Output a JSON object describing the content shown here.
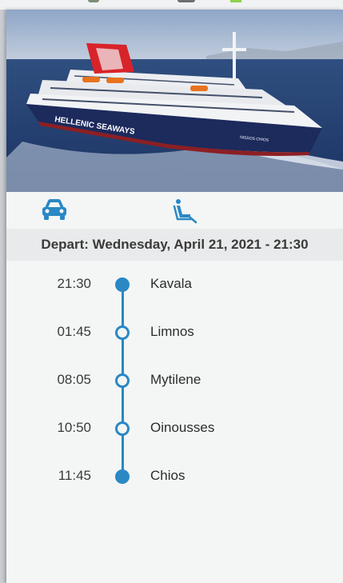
{
  "hero": {
    "image": "ferry-photo",
    "hull_text": "HELLENIC SEAWAYS",
    "ship_name": "NISSOS CHIOS"
  },
  "icons": [
    {
      "name": "car-icon"
    },
    {
      "name": "seat-icon"
    }
  ],
  "depart_label": "Depart: Wednesday, April 21, 2021 - 21:30",
  "stops": [
    {
      "time": "21:30",
      "port": "Kavala",
      "filled": true
    },
    {
      "time": "01:45",
      "port": "Limnos",
      "filled": false
    },
    {
      "time": "08:05",
      "port": "Mytilene",
      "filled": false
    },
    {
      "time": "10:50",
      "port": "Oinousses",
      "filled": false
    },
    {
      "time": "11:45",
      "port": "Chios",
      "filled": true
    }
  ],
  "colors": {
    "accent": "#2a88c4",
    "panel": "#f4f6f6",
    "depart_bar": "#e9eaeb",
    "hull": "#1c2a5c",
    "funnel": "#d8232a"
  }
}
